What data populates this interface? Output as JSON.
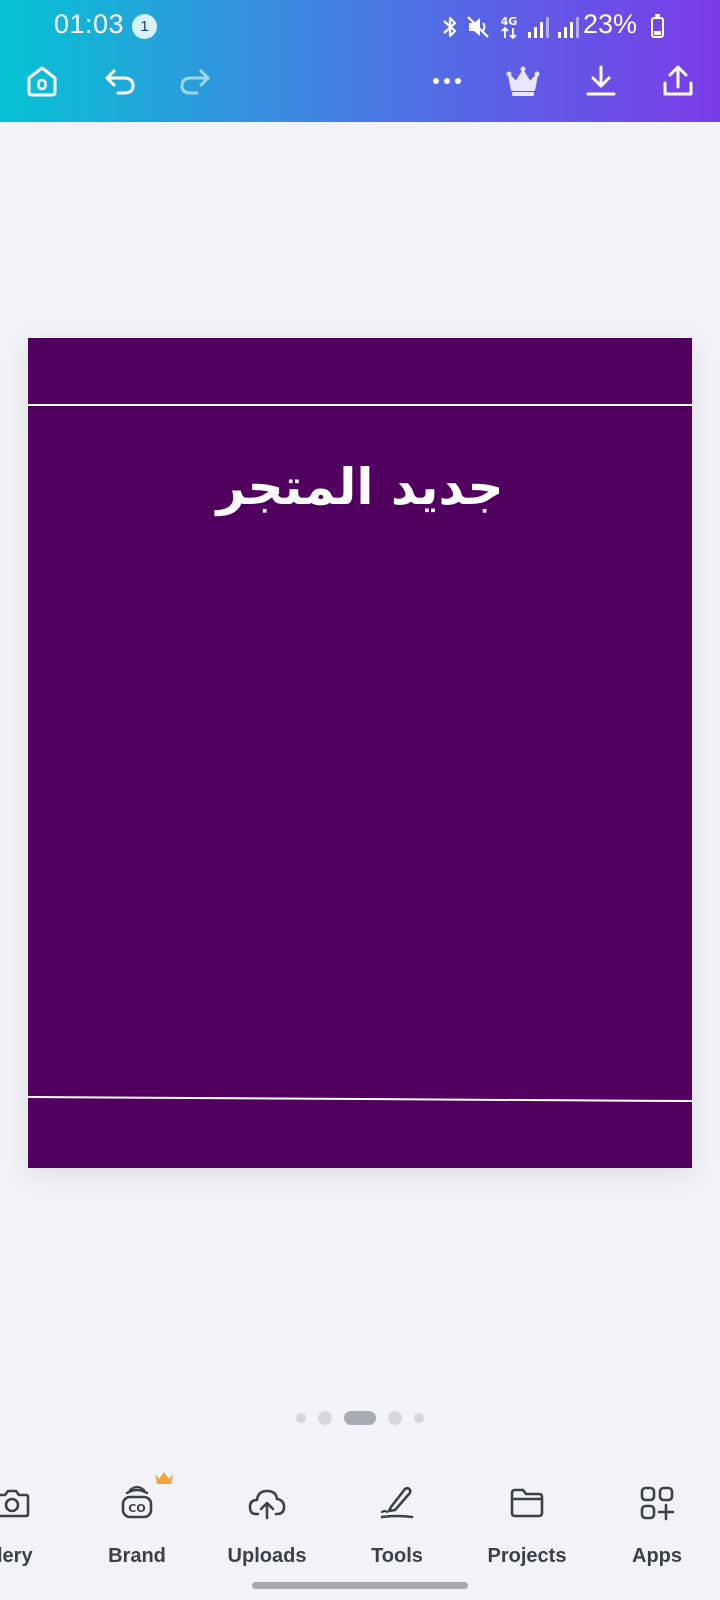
{
  "status_bar": {
    "time": "01:03",
    "notification_count": "1",
    "battery": "23%",
    "battery_level": 0.23,
    "icons": [
      "bluetooth-icon",
      "mute-icon",
      "4g-icon",
      "signal-icon",
      "signal-icon",
      "battery-icon"
    ]
  },
  "toolbar": {
    "home": "home-icon",
    "undo": "undo-icon",
    "redo": "redo-icon",
    "more": "more-icon",
    "premium": "crown-icon",
    "download": "download-icon",
    "share": "share-icon"
  },
  "canvas": {
    "background_color": "#520060",
    "title": "جديد المتجر"
  },
  "pages": {
    "count": 5,
    "active_index": 2
  },
  "bottom_nav": {
    "items": [
      {
        "label": "llery",
        "icon": "camera-icon"
      },
      {
        "label": "Brand",
        "icon": "brand-kit-icon"
      },
      {
        "label": "Uploads",
        "icon": "cloud-upload-icon"
      },
      {
        "label": "Tools",
        "icon": "pen-tool-icon"
      },
      {
        "label": "Projects",
        "icon": "folder-icon"
      },
      {
        "label": "Apps",
        "icon": "apps-grid-icon"
      }
    ]
  },
  "colors": {
    "header_gradient_start": "#05c3d3",
    "header_gradient_end": "#7b3ce8",
    "premium_crown": "#f3a33a",
    "nav_label": "#3d4047"
  }
}
